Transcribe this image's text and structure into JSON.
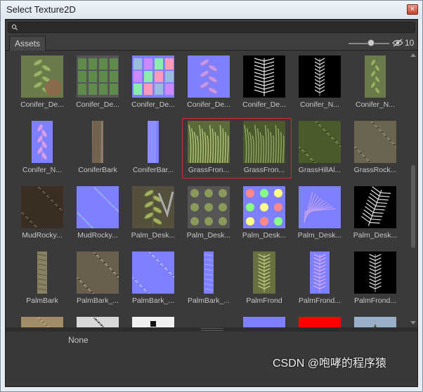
{
  "window": {
    "title": "Select Texture2D",
    "close_label": "×"
  },
  "search": {
    "placeholder": ""
  },
  "toolbar": {
    "assets_tab": "Assets",
    "hidden_count": "10"
  },
  "items": [
    {
      "label": "Conifer_De...",
      "thumb": "conifer-bark-atlas"
    },
    {
      "label": "Conifer_De...",
      "thumb": "conifer-branches"
    },
    {
      "label": "Conifer_De...",
      "thumb": "conifer-branches-normal"
    },
    {
      "label": "Conifer_De...",
      "thumb": "conifer-leaf-normal"
    },
    {
      "label": "Conifer_De...",
      "thumb": "conifer-leaf-mask"
    },
    {
      "label": "Conifer_N...",
      "thumb": "conifer-narrow-mask"
    },
    {
      "label": "Conifer_N...",
      "thumb": "conifer-narrow-color"
    },
    {
      "label": "Conifer_N...",
      "thumb": "conifer-narrow-normal"
    },
    {
      "label": "ConiferBark",
      "thumb": "conifer-bark"
    },
    {
      "label": "ConiferBar...",
      "thumb": "conifer-bark-normal"
    },
    {
      "label": "GrassFron...",
      "thumb": "grass-frond-a"
    },
    {
      "label": "GrassFron...",
      "thumb": "grass-frond-b"
    },
    {
      "label": "GrassHillAl...",
      "thumb": "grass-hill"
    },
    {
      "label": "GrassRock...",
      "thumb": "grass-rock"
    },
    {
      "label": "MudRocky...",
      "thumb": "mud-rocky"
    },
    {
      "label": "MudRocky...",
      "thumb": "mud-rocky-normal"
    },
    {
      "label": "Palm_Desk...",
      "thumb": "palm-atlas"
    },
    {
      "label": "Palm_Desk...",
      "thumb": "palm-leaves"
    },
    {
      "label": "Palm_Desk...",
      "thumb": "palm-leaves-normal"
    },
    {
      "label": "Palm_Desk...",
      "thumb": "palm-frond-normal"
    },
    {
      "label": "Palm_Desk...",
      "thumb": "palm-frond-mask"
    },
    {
      "label": "PalmBark",
      "thumb": "palm-bark"
    },
    {
      "label": "PalmBark_...",
      "thumb": "palm-bark-wood"
    },
    {
      "label": "PalmBark_...",
      "thumb": "palm-bark-normal"
    },
    {
      "label": "PalmBark_...",
      "thumb": "palm-bark-strip-normal"
    },
    {
      "label": "PalmFrond",
      "thumb": "palm-frond"
    },
    {
      "label": "PalmFrond...",
      "thumb": "palm-frond-strip-normal"
    },
    {
      "label": "PalmFrond...",
      "thumb": "palm-frond-strip-mask"
    },
    {
      "label": "",
      "thumb": "sand"
    },
    {
      "label": "",
      "thumb": "speckle-white"
    },
    {
      "label": "",
      "thumb": "white-black"
    },
    {
      "label": "",
      "thumb": "empty"
    },
    {
      "label": "",
      "thumb": "normal-flat"
    },
    {
      "label": "",
      "thumb": "red"
    },
    {
      "label": "",
      "thumb": "sky-tree"
    }
  ],
  "selected_items": [
    "GrassFron...",
    "GrassFron..."
  ],
  "preview": {
    "none_label": "None"
  },
  "watermark": "CSDN @咆哮的程序猿",
  "colors": {
    "panel_bg": "#383838",
    "normal_map": "#7f80ff",
    "selection": "#d82d2d"
  }
}
